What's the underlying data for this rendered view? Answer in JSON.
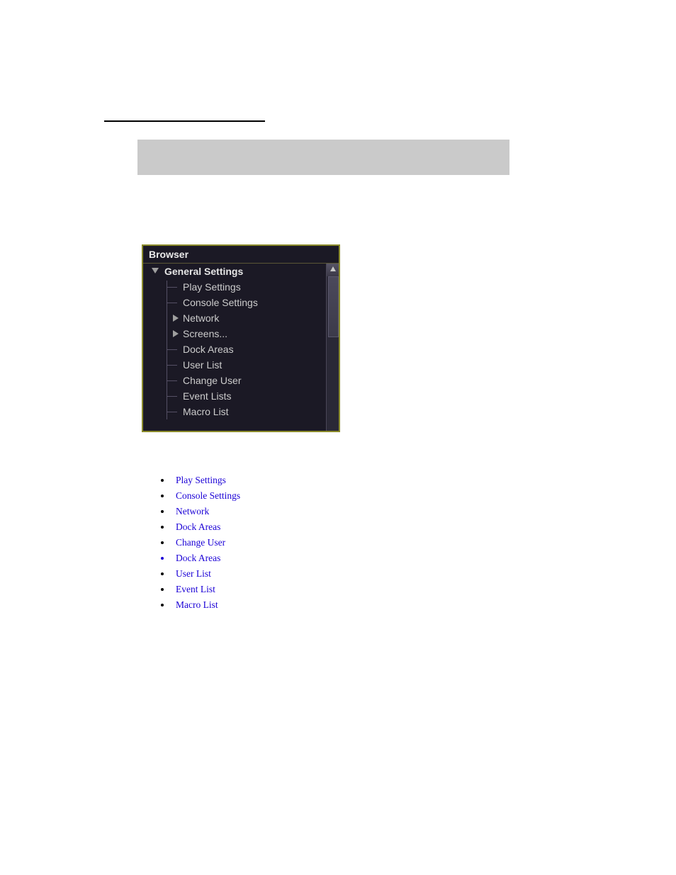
{
  "browser": {
    "title": "Browser",
    "tree": {
      "root": "General Settings",
      "items": [
        {
          "label": "Play Settings",
          "expandable": false
        },
        {
          "label": "Console Settings",
          "expandable": false
        },
        {
          "label": "Network",
          "expandable": true
        },
        {
          "label": "Screens...",
          "expandable": true
        },
        {
          "label": "Dock Areas",
          "expandable": false
        },
        {
          "label": "User List",
          "expandable": false
        },
        {
          "label": "Change User",
          "expandable": false
        },
        {
          "label": "Event Lists",
          "expandable": false
        },
        {
          "label": "Macro List",
          "expandable": false
        }
      ]
    }
  },
  "links": [
    {
      "label": "Play Settings"
    },
    {
      "label": "Console Settings"
    },
    {
      "label": "Network"
    },
    {
      "label": "Dock Areas"
    },
    {
      "label": "Change User"
    },
    {
      "label": "Dock Areas"
    },
    {
      "label": "User List"
    },
    {
      "label": "Event List"
    },
    {
      "label": "Macro List"
    }
  ]
}
